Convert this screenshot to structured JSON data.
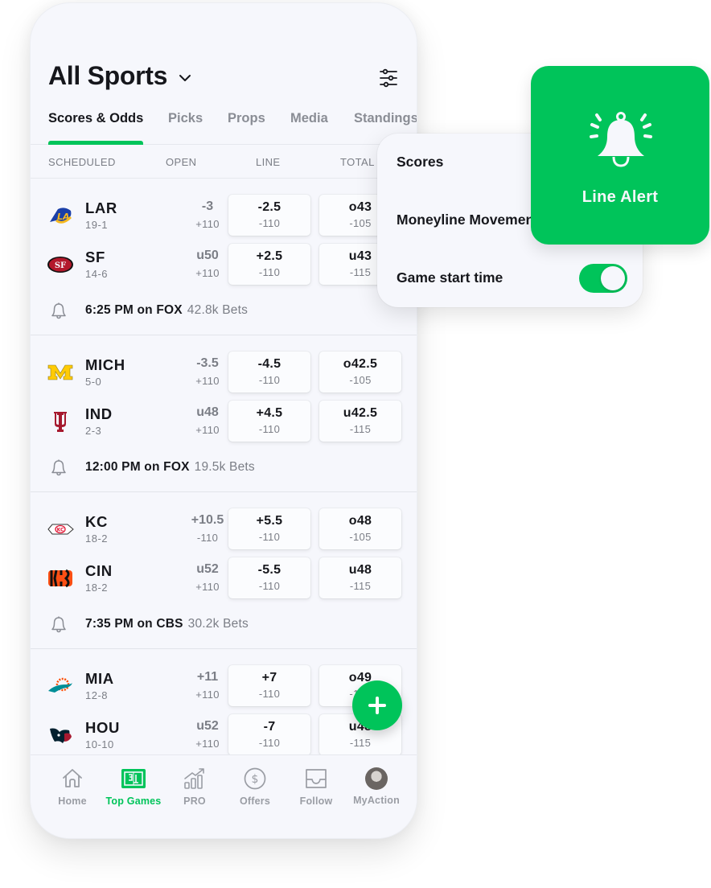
{
  "header": {
    "title": "All Sports",
    "dropdown_icon": "chevron-down-icon",
    "filter_icon": "sliders-icon"
  },
  "tabs": [
    {
      "label": "Scores & Odds",
      "active": true
    },
    {
      "label": "Picks",
      "active": false
    },
    {
      "label": "Props",
      "active": false
    },
    {
      "label": "Media",
      "active": false
    },
    {
      "label": "Standings",
      "active": false
    }
  ],
  "columns": {
    "scheduled": "SCHEDULED",
    "open": "OPEN",
    "line": "LINE",
    "total": "TOTAL"
  },
  "games": [
    {
      "teams": [
        {
          "abbr": "LAR",
          "record": "19-1",
          "open1": "-3",
          "open2": "+110",
          "line1": "-2.5",
          "line2": "-110",
          "total1": "o43",
          "total2": "-105",
          "logo": "rams-logo"
        },
        {
          "abbr": "SF",
          "record": "14-6",
          "open1": "u50",
          "open2": "+110",
          "line1": "+2.5",
          "line2": "-110",
          "total1": "u43",
          "total2": "-115",
          "logo": "49ers-logo"
        }
      ],
      "time": "6:25 PM on FOX",
      "bets": "42.8k Bets"
    },
    {
      "teams": [
        {
          "abbr": "MICH",
          "record": "5-0",
          "open1": "-3.5",
          "open2": "+110",
          "line1": "-4.5",
          "line2": "-110",
          "total1": "o42.5",
          "total2": "-105",
          "logo": "michigan-logo"
        },
        {
          "abbr": "IND",
          "record": "2-3",
          "open1": "u48",
          "open2": "+110",
          "line1": "+4.5",
          "line2": "-110",
          "total1": "u42.5",
          "total2": "-115",
          "logo": "indiana-logo"
        }
      ],
      "time": "12:00 PM on FOX",
      "bets": "19.5k Bets"
    },
    {
      "teams": [
        {
          "abbr": "KC",
          "record": "18-2",
          "open1": "+10.5",
          "open2": "-110",
          "line1": "+5.5",
          "line2": "-110",
          "total1": "o48",
          "total2": "-105",
          "logo": "chiefs-logo"
        },
        {
          "abbr": "CIN",
          "record": "18-2",
          "open1": "u52",
          "open2": "+110",
          "line1": "-5.5",
          "line2": "-110",
          "total1": "u48",
          "total2": "-115",
          "logo": "bengals-logo"
        }
      ],
      "time": "7:35 PM on CBS",
      "bets": "30.2k Bets"
    },
    {
      "teams": [
        {
          "abbr": "MIA",
          "record": "12-8",
          "open1": "+11",
          "open2": "+110",
          "line1": "+7",
          "line2": "-110",
          "total1": "o49",
          "total2": "-105",
          "logo": "dolphins-logo"
        },
        {
          "abbr": "HOU",
          "record": "10-10",
          "open1": "u52",
          "open2": "+110",
          "line1": "-7",
          "line2": "-110",
          "total1": "u48",
          "total2": "-115",
          "logo": "texans-logo"
        }
      ]
    }
  ],
  "nav": [
    {
      "label": "Home",
      "icon": "home-icon",
      "active": false
    },
    {
      "label": "Top Games",
      "icon": "scoreboard-icon",
      "active": true
    },
    {
      "label": "PRO",
      "icon": "chart-up-icon",
      "active": false
    },
    {
      "label": "Offers",
      "icon": "dollar-icon",
      "active": false
    },
    {
      "label": "Follow",
      "icon": "inbox-icon",
      "active": false
    },
    {
      "label": "MyAction",
      "icon": "avatar",
      "active": false
    }
  ],
  "popup": {
    "items": [
      {
        "label": "Scores"
      },
      {
        "label": "Moneyline Movement"
      },
      {
        "label": "Game start time",
        "toggle_on": true
      }
    ]
  },
  "line_alert": {
    "label": "Line Alert"
  },
  "colors": {
    "accent": "#00c45a",
    "background": "#f6f7fc",
    "text": "#16171c",
    "muted": "#7b7e86"
  }
}
